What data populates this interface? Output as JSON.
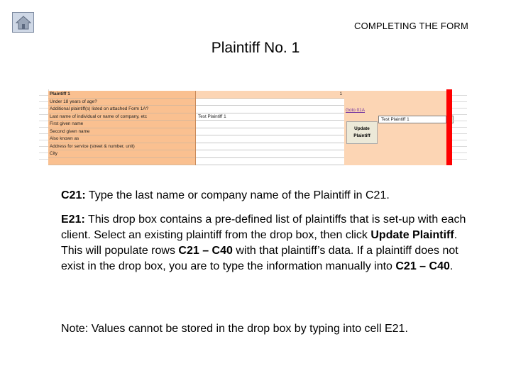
{
  "header": {
    "section": "COMPLETING THE FORM",
    "title": "Plaintiff No. 1"
  },
  "home_button": {
    "icon": "house-icon"
  },
  "spreadsheet": {
    "rows": [
      {
        "label": "Plaintiff 1",
        "value": "",
        "number": "1",
        "bold": true
      },
      {
        "label": "Under 18 years of age?",
        "value": "",
        "number": ""
      },
      {
        "label": "Additional plaintiff(s) listed on attached Form 1A?",
        "value": "",
        "number": ""
      },
      {
        "label": "Last name of individual or name of company, etc",
        "value": "Test Plaintiff 1",
        "number": ""
      },
      {
        "label": "First given name",
        "value": "",
        "number": ""
      },
      {
        "label": "Second given name",
        "value": "",
        "number": ""
      },
      {
        "label": "Also known as",
        "value": "",
        "number": ""
      },
      {
        "label": "Address for service (street & number, unit)",
        "value": "",
        "number": ""
      },
      {
        "label": "City",
        "value": "",
        "number": ""
      },
      {
        "label": "",
        "value": "",
        "number": ""
      }
    ],
    "goto_link": "Goto 01A",
    "dropdown_value": "Test Plaintiff 1",
    "update_button": {
      "line1": "Update",
      "line2": "Plaintiff"
    }
  },
  "instructions": {
    "p1_cell": "C21:",
    "p1_text": " Type the last name or company name of the Plaintiff in ",
    "p1_ref": "C21",
    "p1_end": ".",
    "p2_cell": "E21:",
    "p2_text_a": " This drop box contains a pre-defined list of plaintiffs that is set-up with each client. Select an existing plaintiff from the drop box, then click ",
    "p2_bold_a": "Update Plaintiff",
    "p2_text_b": ". This will populate rows ",
    "p2_bold_b": "C21 – C40",
    "p2_text_c": " with that plaintiff’s data. If a plaintiff does not exist in the drop box, you are to type the information manually into ",
    "p2_bold_c": "C21 – C40",
    "p2_text_d": ".",
    "note": "Note: Values cannot be stored in the drop box by typing into cell E21."
  }
}
